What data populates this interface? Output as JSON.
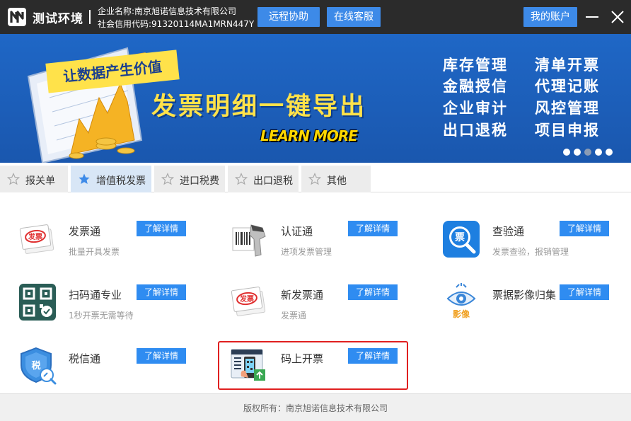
{
  "titlebar": {
    "app_title": "测试环境",
    "company_name": "企业名称:南京旭诺信息技术有限公司",
    "credit_code": "社会信用代码:91320114MA1MRN447Y",
    "remote_button": "远程协助",
    "service_button": "在线客服",
    "account_button": "我的账户"
  },
  "banner": {
    "slogan": "让数据产生价值",
    "headline": "发票明细一键导出",
    "learn_more": "LEARN MORE",
    "features": [
      "库存管理",
      "清单开票",
      "金融授信",
      "代理记账",
      "企业审计",
      "风控管理",
      "出口退税",
      "项目申报"
    ],
    "dots_count": 5,
    "active_dot": 2
  },
  "tabs": [
    {
      "label": "报关单",
      "active": false
    },
    {
      "label": "增值税发票",
      "active": true
    },
    {
      "label": "进口税费",
      "active": false
    },
    {
      "label": "出口退税",
      "active": false
    },
    {
      "label": "其他",
      "active": false
    }
  ],
  "apps": [
    {
      "name": "发票通",
      "desc": "批量开具发票",
      "button": "了解详情",
      "icon": "invoice-stamp-icon"
    },
    {
      "name": "认证通",
      "desc": "进项发票管理",
      "button": "了解详情",
      "icon": "barcode-scanner-icon"
    },
    {
      "name": "查验通",
      "desc": "发票查验，报销管理",
      "button": "了解详情",
      "icon": "invoice-magnifier-icon"
    },
    {
      "name": "扫码通专业",
      "desc": "1秒开票无需等待",
      "button": "了解详情",
      "icon": "qr-code-icon"
    },
    {
      "name": "新发票通",
      "desc": "发票通",
      "button": "了解详情",
      "icon": "invoice-stamp-icon"
    },
    {
      "name": "票据影像归集",
      "desc": "",
      "button": "了解详情",
      "icon": "eye-image-icon"
    },
    {
      "name": "税信通",
      "desc": "",
      "button": "了解详情",
      "icon": "tax-shield-icon"
    },
    {
      "name": "码上开票",
      "desc": "",
      "button": "了解详情",
      "icon": "phone-qr-icon"
    }
  ],
  "icon_labels": {
    "invoice": "发票",
    "ticket": "票",
    "tax": "税",
    "image": "影像"
  },
  "footer": {
    "copyright": "版权所有：南京旭诺信息技术有限公司"
  },
  "colors": {
    "titlebar_bg": "#2b2b2b",
    "button_blue": "#3d8ae8",
    "detail_blue": "#2f8cf1",
    "banner_blue": "#1f67c6",
    "banner_yellow": "#ffe24a",
    "highlight_red": "#e02020",
    "active_tab": "#d8e6f6"
  }
}
